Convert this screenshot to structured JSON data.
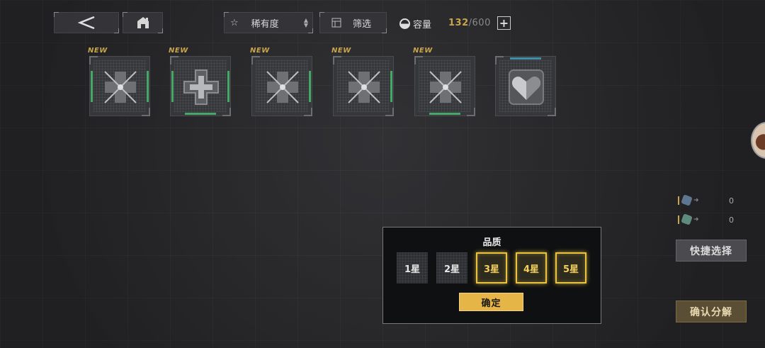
{
  "toolbar": {
    "back_icon": "chevron-left-icon",
    "home_icon": "home-icon",
    "rarity_label": "稀有度",
    "filter_label": "筛选",
    "capacity_label": "容量",
    "capacity_current": "132",
    "capacity_total": "/600"
  },
  "cards": [
    {
      "new_label": "NEW",
      "icon": "crossed-blades-icon",
      "frame_color": "#46a867"
    },
    {
      "new_label": "NEW",
      "icon": "cross-emblem-icon",
      "frame_color": "#46a867"
    },
    {
      "new_label": "NEW",
      "icon": "crossed-blades-icon",
      "frame_color": "#46a867"
    },
    {
      "new_label": "NEW",
      "icon": "crossed-blades-icon",
      "frame_color": "#46a867"
    },
    {
      "new_label": "NEW",
      "icon": "crossed-blades-icon",
      "frame_color": "#46a867"
    },
    {
      "new_label": "",
      "icon": "heart-shield-icon",
      "frame_color": "#3f8fa8"
    }
  ],
  "resources": [
    {
      "icon": "blue-gem-icon",
      "value": "0"
    },
    {
      "icon": "green-gem-icon",
      "value": "0"
    }
  ],
  "side_buttons": {
    "quick_select": "快捷选择",
    "confirm_decompose": "确认分解"
  },
  "quality_popup": {
    "title": "品质",
    "stars": [
      {
        "label": "1星",
        "selected": false
      },
      {
        "label": "2星",
        "selected": false
      },
      {
        "label": "3星",
        "selected": true
      },
      {
        "label": "4星",
        "selected": true
      },
      {
        "label": "5星",
        "selected": true
      }
    ],
    "confirm_label": "确定"
  },
  "colors": {
    "accent_gold": "#e6b547",
    "selected_border": "#e9c23f",
    "rarity_green": "#46a867",
    "rarity_blue": "#3f8fa8",
    "background": "#2b2b2e"
  }
}
